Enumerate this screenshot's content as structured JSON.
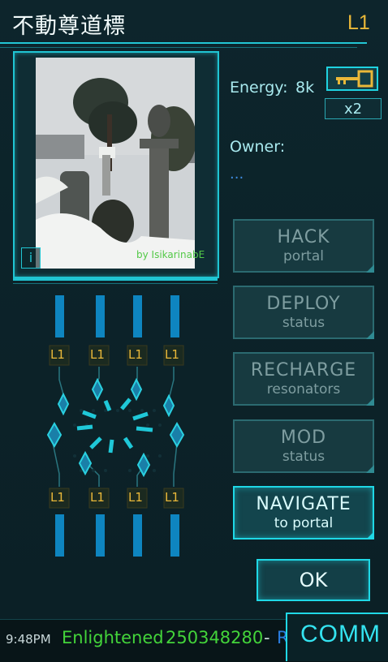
{
  "portal": {
    "title": "不動尊道標",
    "level": "L1",
    "photo_credit": "by IsikarinabE",
    "info_glyph": "i"
  },
  "stats": {
    "energy_label": "Energy:",
    "energy_value": "8k",
    "key_count": "x2",
    "owner_label": "Owner:",
    "owner_value": "..."
  },
  "actions": [
    {
      "line1": "HACK",
      "line2": "portal",
      "enabled": false
    },
    {
      "line1": "DEPLOY",
      "line2": "status",
      "enabled": false
    },
    {
      "line1": "RECHARGE",
      "line2": "resonators",
      "enabled": false
    },
    {
      "line1": "MOD",
      "line2": "status",
      "enabled": false
    },
    {
      "line1": "NAVIGATE",
      "line2": "to portal",
      "enabled": true
    }
  ],
  "ok_label": "OK",
  "resonators": {
    "top_levels": [
      "L1",
      "L1",
      "L1",
      "L1"
    ],
    "bottom_levels": [
      "L1",
      "L1",
      "L1",
      "L1"
    ]
  },
  "status_bar": {
    "time": "9:48PM",
    "faction": "Enlightened",
    "score": "250348280",
    "separator": "-",
    "resistance_fragment": "Re",
    "comm_label": "COMM"
  },
  "colors": {
    "accent": "#1fd8e6",
    "level_gold": "#e9b839",
    "enlightened": "#43d43a",
    "resistance": "#2a7de0"
  }
}
